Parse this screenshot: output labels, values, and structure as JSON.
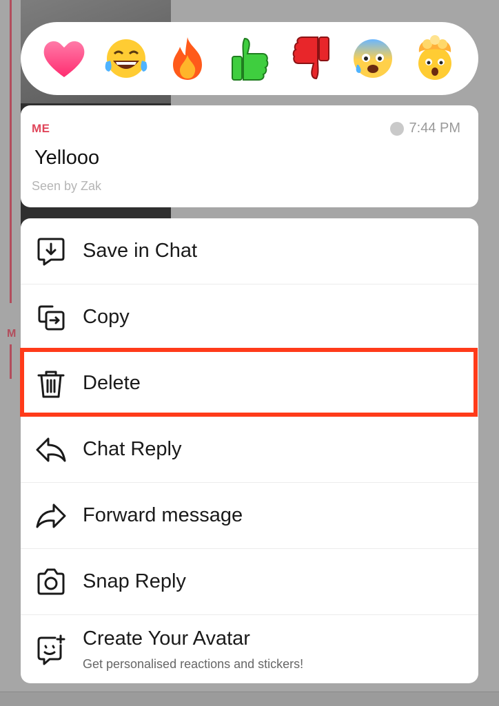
{
  "reactions": [
    {
      "icon": "heart-icon",
      "emoji": "❤"
    },
    {
      "icon": "laughing-tears-icon",
      "emoji": "😂"
    },
    {
      "icon": "fire-icon",
      "emoji": "🔥"
    },
    {
      "icon": "thumbs-up-icon",
      "emoji": "👍"
    },
    {
      "icon": "thumbs-down-icon",
      "emoji": "👎"
    },
    {
      "icon": "anxious-face-icon",
      "emoji": "😰"
    },
    {
      "icon": "exploding-head-icon",
      "emoji": "🤯"
    }
  ],
  "message": {
    "sender": "ME",
    "time": "7:44 PM",
    "text": "Yellooo",
    "seen": "Seen by Zak"
  },
  "menu": {
    "save_in_chat": "Save in Chat",
    "copy": "Copy",
    "delete": "Delete",
    "chat_reply": "Chat Reply",
    "forward_message": "Forward message",
    "snap_reply": "Snap Reply",
    "create_avatar": "Create Your Avatar",
    "create_avatar_sub": "Get personalised reactions and stickers!"
  },
  "background": {
    "partial_sender": "M"
  },
  "colors": {
    "accent_red": "#e0465a",
    "highlight": "#ff3b1a"
  }
}
